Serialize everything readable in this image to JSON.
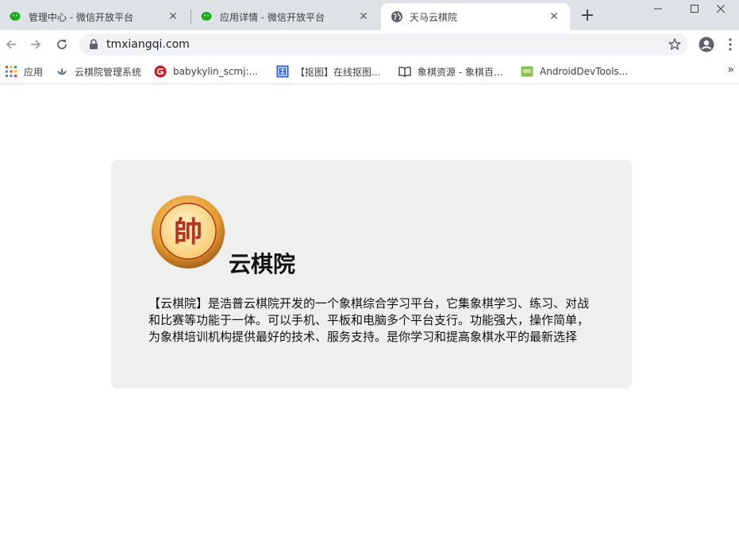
{
  "browser": {
    "tabs": [
      {
        "title": "管理中心 - 微信开放平台",
        "active": false,
        "icon": "wechat-icon"
      },
      {
        "title": "应用详情 - 微信开放平台",
        "active": false,
        "icon": "wechat-icon"
      },
      {
        "title": "天马云棋院",
        "active": true,
        "icon": "globe-icon"
      }
    ],
    "close_glyph": "✕",
    "new_tab_glyph": "+",
    "url": "tmxiangqi.com",
    "bookmarks": [
      {
        "label": "应用",
        "icon": "apps-grid-icon"
      },
      {
        "label": "云棋院管理系统",
        "icon": "lotus-icon"
      },
      {
        "label": "babykylin_scmj:...",
        "icon": "gitee-icon"
      },
      {
        "label": "【抠图】在线抠图...",
        "icon": "koutu-icon"
      },
      {
        "label": "象棋资源 - 象棋百...",
        "icon": "book-icon"
      },
      {
        "label": "AndroidDevTools...",
        "icon": "android-tools-icon"
      }
    ],
    "bookmarks_more_glyph": "»"
  },
  "page": {
    "logo_char": "帥",
    "title": "云棋院",
    "description": "【云棋院】是浩普云棋院开发的一个象棋综合学习平台，它集象棋学习、练习、对战和比赛等功能于一体。可以手机、平板和电脑多个平台支行。功能强大，操作简单，为象棋培训机构提供最好的技术、服务支持。是你学习和提高象棋水平的最新选择"
  },
  "colors": {
    "tabstrip_bg": "#dee1e6",
    "card_bg": "#efefef",
    "wechat_green": "#1aad19",
    "logo_gold": "#e8a23a",
    "logo_red": "#b5331f"
  }
}
